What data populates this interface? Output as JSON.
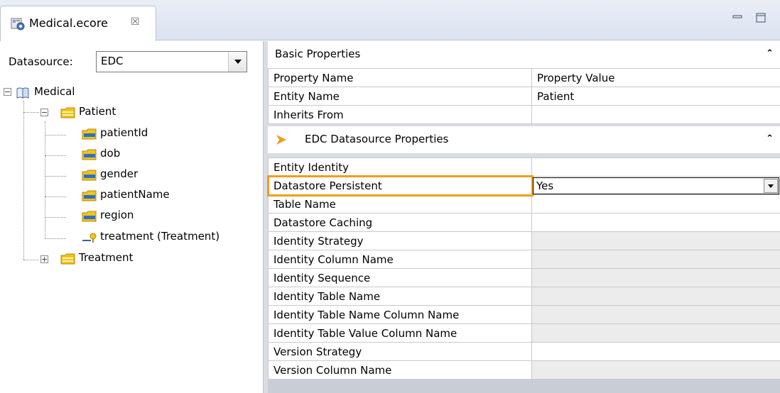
{
  "tab": {
    "label": "Medical.ecore",
    "close_glyph": "☒",
    "minimize_glyph": "▭",
    "maximize_glyph": "◻"
  },
  "datasource": {
    "label": "Datasource:",
    "value": "EDC"
  },
  "tree": {
    "root": {
      "label": "Medical",
      "expander": "−"
    },
    "patient": {
      "label": "Patient",
      "expander": "−"
    },
    "attributes": [
      "patientId",
      "dob",
      "gender",
      "patientName",
      "region"
    ],
    "reference": "treatment (Treatment)",
    "treatment": {
      "label": "Treatment",
      "expander": "+"
    }
  },
  "basic": {
    "title": "Basic Properties",
    "collapse_glyph": "⌃",
    "header": [
      "Property Name",
      "Property Value"
    ],
    "rows": [
      {
        "name": "Entity Name",
        "value": "Patient"
      },
      {
        "name": "Inherits From",
        "value": ""
      }
    ]
  },
  "edc": {
    "title": "EDC Datasource Properties",
    "collapse_glyph": "⌃",
    "rows": [
      {
        "name": "Entity Identity",
        "value": ""
      },
      {
        "name": "Datastore Persistent",
        "value": "Yes"
      },
      {
        "name": "Table Name",
        "value": ""
      },
      {
        "name": "Datastore Caching",
        "value": ""
      },
      {
        "name": "Identity Strategy",
        "value": ""
      },
      {
        "name": "Identity Column Name",
        "value": ""
      },
      {
        "name": "Identity Sequence",
        "value": ""
      },
      {
        "name": "Identity Table Name",
        "value": ""
      },
      {
        "name": "Identity Table Name Column Name",
        "value": ""
      },
      {
        "name": "Identity Table Value Column Name",
        "value": ""
      },
      {
        "name": "Version Strategy",
        "value": ""
      },
      {
        "name": "Version Column Name",
        "value": ""
      }
    ]
  },
  "colors": {
    "highlight": "#f39c1f",
    "folder": "#f0c419",
    "field_blue": "#2f6fbf",
    "arrow": "#f39c1f"
  }
}
